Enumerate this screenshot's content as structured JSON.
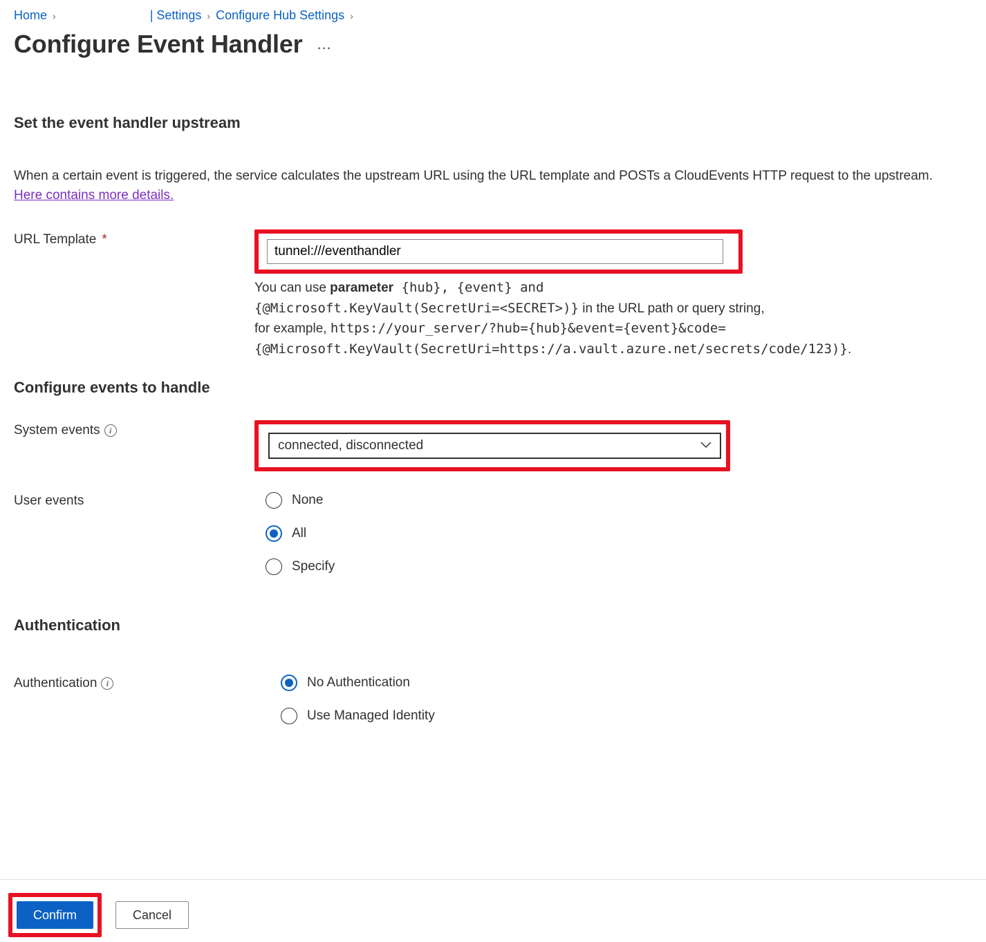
{
  "breadcrumb": {
    "home": "Home",
    "settings": "| Settings",
    "configure_hub": "Configure Hub Settings"
  },
  "page_title": "Configure Event Handler",
  "section_upstream": {
    "heading": "Set the event handler upstream",
    "desc_prefix": "When a certain event is triggered, the service calculates the upstream URL using the URL template and POSTs a CloudEvents HTTP request to the upstream. ",
    "desc_link": "Here contains more details."
  },
  "url_template": {
    "label": "URL Template",
    "value": "tunnel:///eventhandler",
    "help_1a": "You can use ",
    "help_1b": "parameter",
    "help_1c": " {hub}, {event} and",
    "help_2": "{@Microsoft.KeyVault(SecretUri=<SECRET>)}",
    "help_2b": " in the URL path or query string,",
    "help_3a": "for example, ",
    "help_3b": "https://your_server/?hub={hub}&event={event}&code=",
    "help_4": "{@Microsoft.KeyVault(SecretUri=https://a.vault.azure.net/secrets/code/123)}",
    "help_4b": "."
  },
  "section_events": {
    "heading": "Configure events to handle"
  },
  "system_events": {
    "label": "System events",
    "value": "connected, disconnected"
  },
  "user_events": {
    "label": "User events",
    "options": {
      "none": "None",
      "all": "All",
      "specify": "Specify"
    },
    "selected": "all"
  },
  "section_auth": {
    "heading": "Authentication"
  },
  "auth": {
    "label": "Authentication",
    "options": {
      "none": "No Authentication",
      "mi": "Use Managed Identity"
    },
    "selected": "none"
  },
  "footer": {
    "confirm": "Confirm",
    "cancel": "Cancel"
  }
}
